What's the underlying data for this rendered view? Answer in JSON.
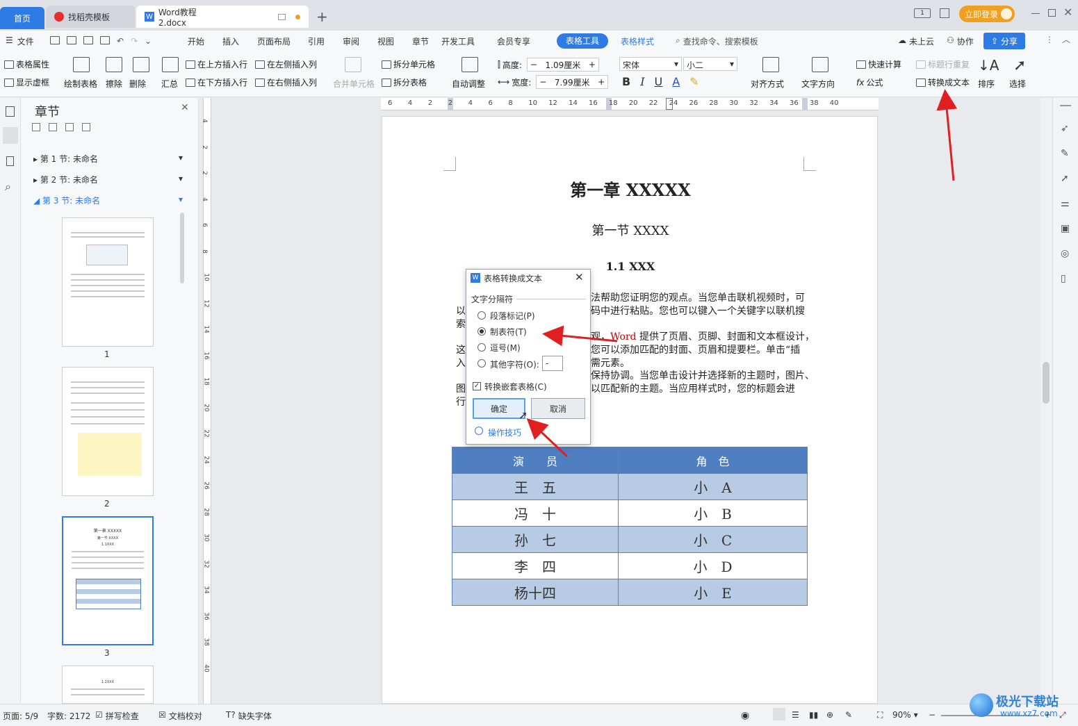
{
  "tabs": {
    "home": "首页",
    "template": "找稻壳模板",
    "doc": "Word教程2.docx"
  },
  "titlebar": {
    "login": "立即登录"
  },
  "menu": {
    "file": "文件",
    "items": [
      "开始",
      "插入",
      "页面布局",
      "引用",
      "审阅",
      "视图",
      "章节",
      "开发工具",
      "会员专享"
    ],
    "active": "表格工具",
    "table_style": "表格样式",
    "search": "查找命令、搜索模板",
    "cloud": "未上云",
    "collab": "协作",
    "share": "分享"
  },
  "ribbon": {
    "table_props": "表格属性",
    "show_grid": "显示虚框",
    "draw_table": "绘制表格",
    "erase": "擦除",
    "delete": "删除",
    "summary": "汇总",
    "insert_above": "在上方插入行",
    "insert_below": "在下方插入行",
    "insert_left": "在左侧插入列",
    "insert_right": "在右侧插入列",
    "merge": "合并单元格",
    "split_cell": "拆分单元格",
    "split_table": "拆分表格",
    "autofit": "自动调整",
    "height_label": "高度:",
    "height_value": "1.09厘米",
    "width_label": "宽度:",
    "width_value": "7.99厘米",
    "font": "宋体",
    "size": "小二",
    "align": "对齐方式",
    "text_dir": "文字方向",
    "quick_calc": "快速计算",
    "repeat_header": "标题行重复",
    "formula": "公式",
    "to_text": "转换成文本",
    "sort": "排序",
    "select": "选择"
  },
  "ruler": {
    "h": [
      "6",
      "4",
      "2",
      "2",
      "4",
      "6",
      "8",
      "10",
      "12",
      "14",
      "16",
      "18",
      "20",
      "22",
      "24",
      "26",
      "28",
      "30",
      "32",
      "34",
      "36",
      "38",
      "40"
    ],
    "v": [
      "4",
      "2",
      "2",
      "4",
      "6",
      "8",
      "10",
      "12",
      "14",
      "16",
      "18",
      "20",
      "22",
      "24",
      "26",
      "28",
      "30",
      "32",
      "34",
      "36",
      "38",
      "40"
    ]
  },
  "panel": {
    "title": "章节",
    "sections": [
      "第 1 节: 未命名",
      "第 2 节: 未命名",
      "第 3 节: 未命名"
    ],
    "pages": [
      "1",
      "2",
      "3"
    ],
    "thumb_page3_title": "第一章 XXXXX",
    "thumb_page3_sub": "第一节 XXXX",
    "thumb_page3_h": "1.1XXX",
    "thumb_page4_h": "1.2XXX"
  },
  "document": {
    "chapter": "第一章  XXXXX",
    "section": "第一节  XXXX",
    "heading": "1.1 XXX",
    "line1": "法帮助您证明您的观点。当您单击联机视频时，可",
    "line2_a": "以",
    "line2_b": "码中进行粘贴。您也可以键入一个关键字以联机搜",
    "line3_a": "索",
    "line4_a": "观，",
    "line4_word": "Word",
    "line4_b": " 提供了页眉、页脚、封面和文本框设计，",
    "line5_a": "这",
    "line5_b": "您可以添加匹配的封面、页眉和提要栏。单击“插",
    "line6_a": "入",
    "line6_b": "需元素。",
    "line7": "保持协调。当您单击设计并选择新的主题时，图片、",
    "line8_a": "图",
    "line8_b": "以匹配新的主题。当应用样式时，您的标题会进",
    "line9_a": "行",
    "table": {
      "headers": [
        "演　　员",
        "角　色"
      ],
      "rows": [
        [
          "王　五",
          "小　A"
        ],
        [
          "冯　十",
          "小　B"
        ],
        [
          "孙　七",
          "小　C"
        ],
        [
          "李　四",
          "小　D"
        ],
        [
          "杨十四",
          "小　E"
        ]
      ]
    }
  },
  "dialog": {
    "title": "表格转换成文本",
    "group": "文字分隔符",
    "opt1": "段落标记(P)",
    "opt2": "制表符(T)",
    "opt3": "逗号(M)",
    "opt4": "其他字符(O):",
    "other_value": "-",
    "nested": "转换嵌套表格(C)",
    "ok": "确定",
    "cancel": "取消",
    "tips": "操作技巧"
  },
  "status": {
    "page": "页面: 5/9",
    "words": "字数: 2172",
    "spell": "拼写检查",
    "proof": "文档校对",
    "font_missing": "缺失字体",
    "zoom": "90%"
  },
  "watermark": {
    "brand": "极光下载站",
    "url": "www.xz7.com"
  },
  "colors": {
    "accent": "#2e7be6",
    "table_header": "#4f7ec1",
    "table_band": "#b8cbe4",
    "login": "#f0a020",
    "arrow": "#e02020"
  }
}
